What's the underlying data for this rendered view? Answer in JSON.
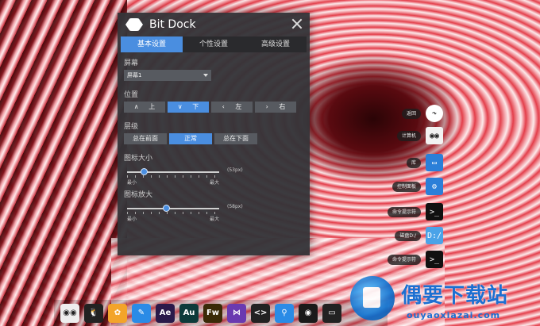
{
  "window": {
    "title": "Bit Dock"
  },
  "tabs": [
    {
      "label": "基本设置",
      "active": true
    },
    {
      "label": "个性设置",
      "active": false
    },
    {
      "label": "高级设置",
      "active": false
    }
  ],
  "screen": {
    "label": "屏幕",
    "selected": "屏幕1"
  },
  "position": {
    "label": "位置",
    "options": [
      {
        "arrow": "∧",
        "label": "上",
        "active": false
      },
      {
        "arrow": "∨",
        "label": "下",
        "active": true
      },
      {
        "arrow": "‹",
        "label": "左",
        "active": false
      },
      {
        "arrow": "›",
        "label": "右",
        "active": false
      }
    ]
  },
  "layer": {
    "label": "层级",
    "options": [
      {
        "label": "总在前面",
        "active": false
      },
      {
        "label": "正常",
        "active": true
      },
      {
        "label": "总在下面",
        "active": false
      }
    ]
  },
  "icon_size": {
    "label": "图标大小",
    "value_text": "(53px)",
    "min": "最小",
    "max": "最大",
    "fraction": 0.18
  },
  "icon_zoom": {
    "label": "图标放大",
    "value_text": "(58px)",
    "min": "最小",
    "max": "最大",
    "fraction": 0.42
  },
  "side_dock": [
    {
      "label": "返回",
      "icon": "back-arrow-icon",
      "color": "#ffffff",
      "glyph": "↷"
    },
    {
      "label": "计算机",
      "icon": "computer-icon",
      "color": "#f2f2f2",
      "glyph": "◉◉"
    },
    {
      "label": "库",
      "icon": "library-icon",
      "color": "#2b7fd8",
      "glyph": "▭"
    },
    {
      "label": "控制面板",
      "icon": "gear-icon",
      "color": "#2b7fd8",
      "glyph": "⚙"
    },
    {
      "label": "命令提示符",
      "icon": "terminal-icon",
      "color": "#111111",
      "glyph": ">_"
    },
    {
      "label": "磁盘D:/",
      "icon": "drive-icon",
      "color": "#4aa3e8",
      "glyph": "D:/"
    },
    {
      "label": "命令提示符",
      "icon": "terminal-icon",
      "color": "#111111",
      "glyph": ">_"
    }
  ],
  "bottom_dock": [
    {
      "icon": "computer-icon",
      "color": "#eeeeee",
      "text": "◉◉"
    },
    {
      "icon": "qq-penguin-icon",
      "color": "#222222",
      "text": "🐧"
    },
    {
      "icon": "color-wheel-icon",
      "color": "#f3a42a",
      "text": "✿"
    },
    {
      "icon": "pencil-icon",
      "color": "#2a8be6",
      "text": "✎"
    },
    {
      "icon": "after-effects-icon",
      "color": "#2a1a4a",
      "text": "Ae"
    },
    {
      "icon": "audition-icon",
      "color": "#0d3a3a",
      "text": "Au"
    },
    {
      "icon": "fireworks-icon",
      "color": "#3a2a08",
      "text": "Fw"
    },
    {
      "icon": "visual-studio-icon",
      "color": "#6a3ab0",
      "text": "⋈"
    },
    {
      "icon": "code-tag-icon",
      "color": "#222222",
      "text": "<>"
    },
    {
      "icon": "search-icon",
      "color": "#2a8be6",
      "text": "⚲"
    },
    {
      "icon": "eye-icon",
      "color": "#1a1a1a",
      "text": "◉"
    },
    {
      "icon": "window-icon",
      "color": "#222222",
      "text": "▭"
    }
  ],
  "watermark": {
    "main": "偶要下载站",
    "sub": "ouyaoxiazai.com"
  }
}
